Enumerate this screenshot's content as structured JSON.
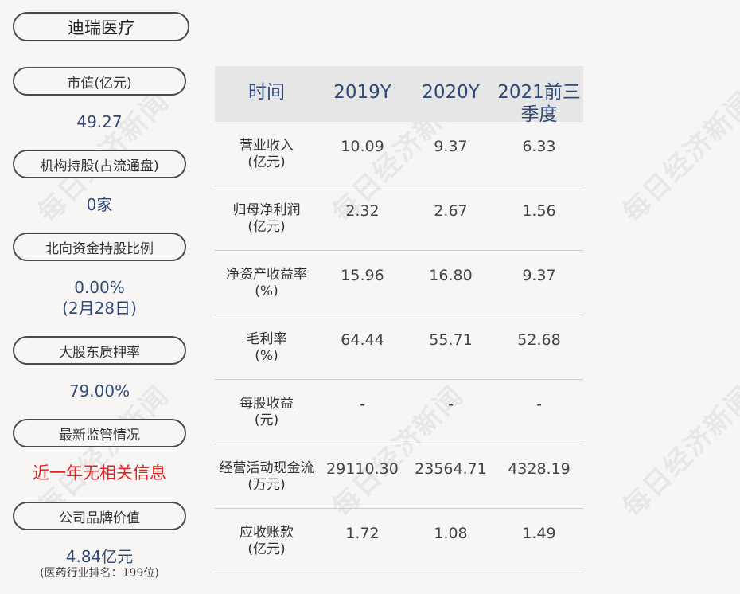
{
  "company": "迪瑞医疗",
  "watermark_text": "每日经济新闻",
  "metrics": [
    {
      "label": "市值(亿元)",
      "value": "49.27"
    },
    {
      "label": "机构持股(占流通盘)",
      "value": "0家"
    },
    {
      "label": "北向资金持股比例",
      "value": "0.00%",
      "value2": "(2月28日)"
    },
    {
      "label": "大股东质押率",
      "value": "79.00%"
    },
    {
      "label": "最新监管情况",
      "value": "近一年无相关信息"
    },
    {
      "label": "公司品牌价值",
      "value": "4.84亿元",
      "note": "(医药行业排名：199位)"
    }
  ],
  "table": {
    "headers": [
      "时间",
      "2019Y",
      "2020Y",
      "2021前三季度"
    ],
    "rows": [
      {
        "name": "营业收入",
        "unit": "(亿元)",
        "v2019": "10.09",
        "v2020": "9.37",
        "v2021": "6.33"
      },
      {
        "name": "归母净利润",
        "unit": "(亿元)",
        "v2019": "2.32",
        "v2020": "2.67",
        "v2021": "1.56"
      },
      {
        "name": "净资产收益率",
        "unit": "(%)",
        "v2019": "15.96",
        "v2020": "16.80",
        "v2021": "9.37"
      },
      {
        "name": "毛利率",
        "unit": "(%)",
        "v2019": "64.44",
        "v2020": "55.71",
        "v2021": "52.68"
      },
      {
        "name": "每股收益",
        "unit": "(元)",
        "v2019": "-",
        "v2020": "-",
        "v2021": "-"
      },
      {
        "name": "经营活动现金流",
        "unit": "(万元)",
        "v2019": "29110.30",
        "v2020": "23564.71",
        "v2021": "4328.19"
      },
      {
        "name": "应收账款",
        "unit": "(亿元)",
        "v2019": "1.72",
        "v2020": "1.08",
        "v2021": "1.49"
      }
    ]
  },
  "colors": {
    "value_blue": "#2f4a7a",
    "alert_red": "#e02424",
    "header_bg": "#e6e6e6"
  }
}
